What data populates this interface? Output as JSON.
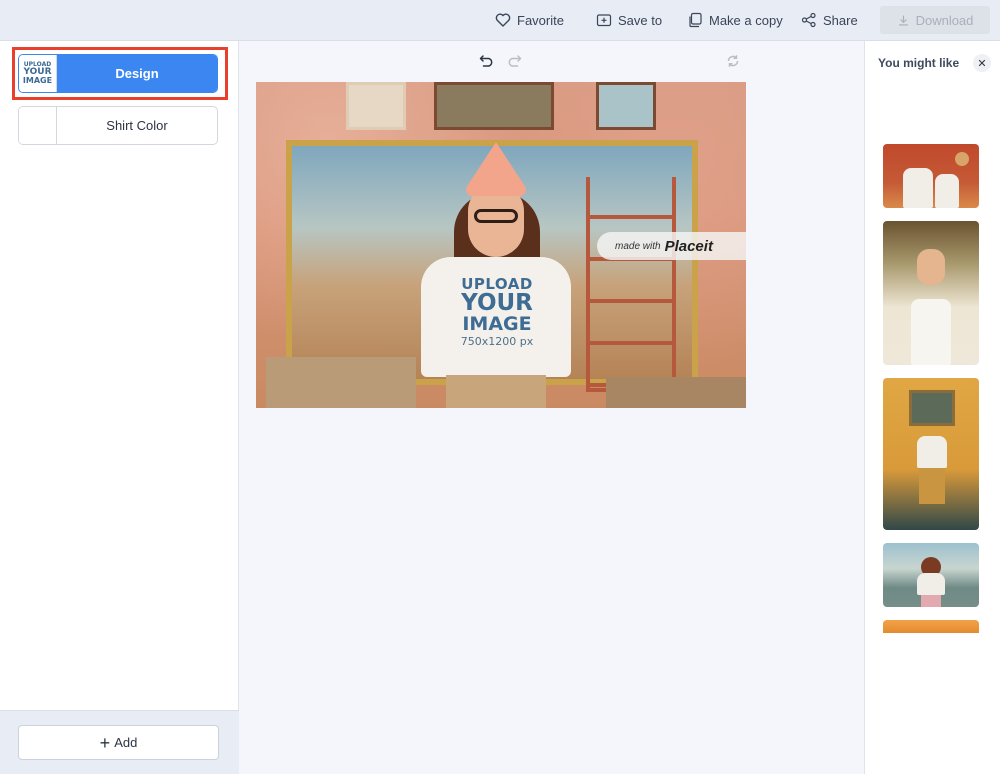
{
  "topbar": {
    "favorite_label": "Favorite",
    "save_to_label": "Save to",
    "make_copy_label": "Make a copy",
    "share_label": "Share",
    "download_label": "Download",
    "download_disabled": true
  },
  "sidebar": {
    "layers": [
      {
        "label": "Design",
        "thumb_lines": [
          "UPLOAD",
          "YOUR",
          "IMAGE"
        ],
        "active": true
      },
      {
        "label": "Shirt Color",
        "active": false
      }
    ],
    "add_label": "Add"
  },
  "canvas": {
    "toolbar": {
      "undo": "undo-icon",
      "redo": "redo-icon",
      "refresh": "refresh-icon"
    },
    "mockup": {
      "print_lines": [
        "UPLOAD",
        "YOUR",
        "IMAGE",
        "750x1200 px"
      ],
      "watermark_prefix": "made with",
      "watermark_brand": "Placeit"
    }
  },
  "recommendations": {
    "title": "You might like",
    "close_icon": "close-icon",
    "items": [
      {
        "name": "couple-orange-room"
      },
      {
        "name": "woman-fur-coat"
      },
      {
        "name": "man-train-cabin"
      },
      {
        "name": "girl-seaside"
      },
      {
        "name": "orange-partial"
      }
    ]
  }
}
